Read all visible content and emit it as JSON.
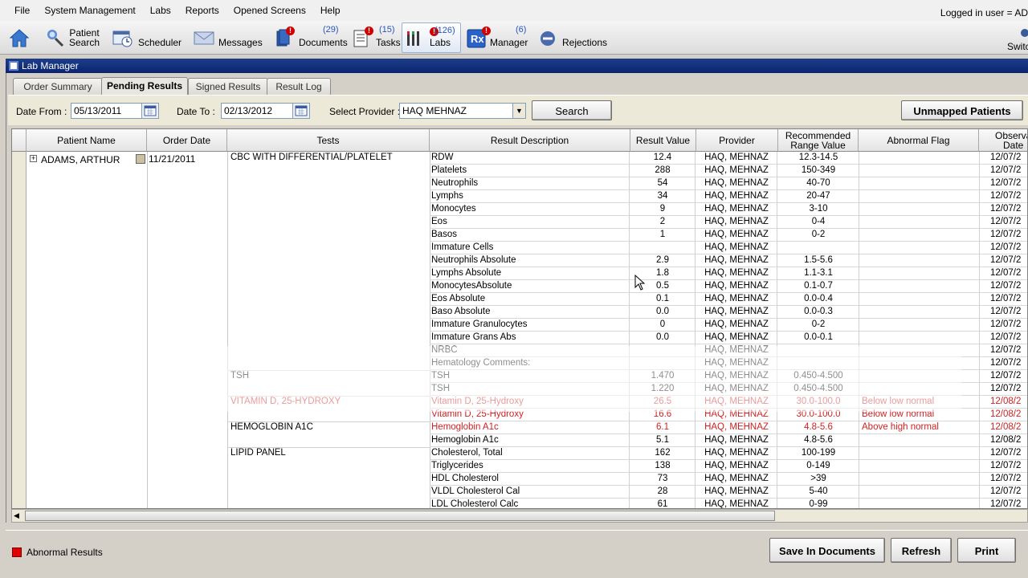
{
  "menu": [
    "File",
    "System Management",
    "Labs",
    "Reports",
    "Opened Screens",
    "Help"
  ],
  "login_text": "Logged in user = AD",
  "toolbar": {
    "home": "",
    "patient_search_line1": "Patient",
    "patient_search_line2": "Search",
    "scheduler": "Scheduler",
    "messages": "Messages",
    "documents": "Documents",
    "documents_count": "(29)",
    "tasks": "Tasks",
    "tasks_count": "(15)",
    "labs": "Labs",
    "labs_count": "(126)",
    "manager": "Manager",
    "manager_count": "(6)",
    "rejections": "Rejections",
    "switch": "Switc"
  },
  "window_title": "Lab Manager",
  "tabs": [
    "Order Summary",
    "Pending Results",
    "Signed Results",
    "Result Log"
  ],
  "active_tab": "Pending Results",
  "filters": {
    "date_from_label": "Date From :",
    "date_from": "05/13/2011",
    "date_to_label": "Date To :",
    "date_to": "02/13/2012",
    "provider_label": "Select Provider :",
    "provider": "HAQ MEHNAZ",
    "search_label": "Search",
    "unmapped_label": "Unmapped Patients"
  },
  "columns": [
    "Patient Name",
    "Order Date",
    "Tests",
    "Result Description",
    "Result Value",
    "Provider",
    "Recommended Range Value",
    "Abnormal Flag",
    "Observa Date"
  ],
  "patient": {
    "name": "ADAMS, ARTHUR",
    "order_date": "11/21/2011"
  },
  "tests": [
    {
      "name": "CBC WITH DIFFERENTIAL/PLATELET",
      "row": 0,
      "red": false
    },
    {
      "name": "TSH",
      "row": 17,
      "red": false
    },
    {
      "name": "VITAMIN D, 25-HYDROXY",
      "row": 19,
      "red": true
    },
    {
      "name": "HEMOGLOBIN A1C",
      "row": 21,
      "red": false
    },
    {
      "name": "LIPID PANEL",
      "row": 23,
      "red": false
    }
  ],
  "rows": [
    {
      "desc": "RDW",
      "val": "12.4",
      "prov": "HAQ, MEHNAZ",
      "range": "12.3-14.5",
      "flag": "",
      "obs": "12/07/2",
      "red": false
    },
    {
      "desc": "Platelets",
      "val": "288",
      "prov": "HAQ, MEHNAZ",
      "range": "150-349",
      "flag": "",
      "obs": "12/07/2",
      "red": false
    },
    {
      "desc": "Neutrophils",
      "val": "54",
      "prov": "HAQ, MEHNAZ",
      "range": "40-70",
      "flag": "",
      "obs": "12/07/2",
      "red": false
    },
    {
      "desc": "Lymphs",
      "val": "34",
      "prov": "HAQ, MEHNAZ",
      "range": "20-47",
      "flag": "",
      "obs": "12/07/2",
      "red": false
    },
    {
      "desc": "Monocytes",
      "val": "9",
      "prov": "HAQ, MEHNAZ",
      "range": "3-10",
      "flag": "",
      "obs": "12/07/2",
      "red": false
    },
    {
      "desc": "Eos",
      "val": "2",
      "prov": "HAQ, MEHNAZ",
      "range": "0-4",
      "flag": "",
      "obs": "12/07/2",
      "red": false
    },
    {
      "desc": "Basos",
      "val": "1",
      "prov": "HAQ, MEHNAZ",
      "range": "0-2",
      "flag": "",
      "obs": "12/07/2",
      "red": false
    },
    {
      "desc": "Immature Cells",
      "val": "",
      "prov": "HAQ, MEHNAZ",
      "range": "",
      "flag": "",
      "obs": "12/07/2",
      "red": false
    },
    {
      "desc": "Neutrophils Absolute",
      "val": "2.9",
      "prov": "HAQ, MEHNAZ",
      "range": "1.5-5.6",
      "flag": "",
      "obs": "12/07/2",
      "red": false
    },
    {
      "desc": "Lymphs Absolute",
      "val": "1.8",
      "prov": "HAQ, MEHNAZ",
      "range": "1.1-3.1",
      "flag": "",
      "obs": "12/07/2",
      "red": false
    },
    {
      "desc": "MonocytesAbsolute",
      "val": "0.5",
      "prov": "HAQ, MEHNAZ",
      "range": "0.1-0.7",
      "flag": "",
      "obs": "12/07/2",
      "red": false
    },
    {
      "desc": "Eos Absolute",
      "val": "0.1",
      "prov": "HAQ, MEHNAZ",
      "range": "0.0-0.4",
      "flag": "",
      "obs": "12/07/2",
      "red": false
    },
    {
      "desc": "Baso Absolute",
      "val": "0.0",
      "prov": "HAQ, MEHNAZ",
      "range": "0.0-0.3",
      "flag": "",
      "obs": "12/07/2",
      "red": false
    },
    {
      "desc": "Immature Granulocytes",
      "val": "0",
      "prov": "HAQ, MEHNAZ",
      "range": "0-2",
      "flag": "",
      "obs": "12/07/2",
      "red": false
    },
    {
      "desc": "Immature Grans Abs",
      "val": "0.0",
      "prov": "HAQ, MEHNAZ",
      "range": "0.0-0.1",
      "flag": "",
      "obs": "12/07/2",
      "red": false
    },
    {
      "desc": "NRBC",
      "val": "",
      "prov": "HAQ, MEHNAZ",
      "range": "",
      "flag": "",
      "obs": "12/07/2",
      "red": false
    },
    {
      "desc": "Hematology Comments:",
      "val": "",
      "prov": "HAQ, MEHNAZ",
      "range": "",
      "flag": "",
      "obs": "12/07/2",
      "red": false
    },
    {
      "desc": "TSH",
      "val": "1.470",
      "prov": "HAQ, MEHNAZ",
      "range": "0.450-4.500",
      "flag": "",
      "obs": "12/07/2",
      "red": false
    },
    {
      "desc": "TSH",
      "val": "1.220",
      "prov": "HAQ, MEHNAZ",
      "range": "0.450-4.500",
      "flag": "",
      "obs": "12/07/2",
      "red": false
    },
    {
      "desc": "Vitamin D, 25-Hydroxy",
      "val": "26.5",
      "prov": "HAQ, MEHNAZ",
      "range": "30.0-100.0",
      "flag": "Below low normal",
      "obs": "12/08/2",
      "red": true
    },
    {
      "desc": "Vitamin D, 25-Hydroxy",
      "val": "16.6",
      "prov": "HAQ, MEHNAZ",
      "range": "30.0-100.0",
      "flag": "Below low normal",
      "obs": "12/08/2",
      "red": true
    },
    {
      "desc": "Hemoglobin A1c",
      "val": "6.1",
      "prov": "HAQ, MEHNAZ",
      "range": "4.8-5.6",
      "flag": "Above high normal",
      "obs": "12/08/2",
      "red": true
    },
    {
      "desc": "Hemoglobin A1c",
      "val": "5.1",
      "prov": "HAQ, MEHNAZ",
      "range": "4.8-5.6",
      "flag": "",
      "obs": "12/08/2",
      "red": false
    },
    {
      "desc": "Cholesterol, Total",
      "val": "162",
      "prov": "HAQ, MEHNAZ",
      "range": "100-199",
      "flag": "",
      "obs": "12/07/2",
      "red": false
    },
    {
      "desc": "Triglycerides",
      "val": "138",
      "prov": "HAQ, MEHNAZ",
      "range": "0-149",
      "flag": "",
      "obs": "12/07/2",
      "red": false
    },
    {
      "desc": "HDL Cholesterol",
      "val": "73",
      "prov": "HAQ, MEHNAZ",
      "range": ">39",
      "flag": "",
      "obs": "12/07/2",
      "red": false
    },
    {
      "desc": "VLDL Cholesterol Cal",
      "val": "28",
      "prov": "HAQ, MEHNAZ",
      "range": "5-40",
      "flag": "",
      "obs": "12/07/2",
      "red": false
    },
    {
      "desc": "LDL Cholesterol Calc",
      "val": "61",
      "prov": "HAQ, MEHNAZ",
      "range": "0-99",
      "flag": "",
      "obs": "12/07/2",
      "red": false
    }
  ],
  "footer": {
    "legend": "Abnormal Results",
    "save_label": "Save In Documents",
    "refresh_label": "Refresh",
    "print_label": "Print"
  },
  "colors": {
    "abnormal": "#d42020",
    "title_bar": "#0a2470",
    "count": "#2a54b8"
  }
}
